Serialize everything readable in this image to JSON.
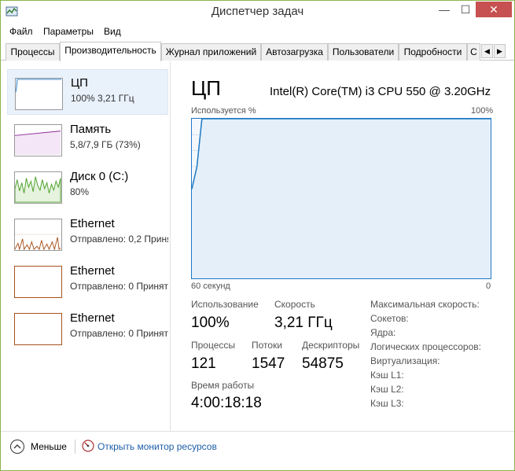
{
  "window": {
    "title": "Диспетчер задач",
    "close_glyph": "✕",
    "min_glyph": "—",
    "max_glyph": "☐"
  },
  "menu": [
    "Файл",
    "Параметры",
    "Вид"
  ],
  "tabs": [
    {
      "label": "Процессы",
      "active": false
    },
    {
      "label": "Производительность",
      "active": true
    },
    {
      "label": "Журнал приложений",
      "active": false
    },
    {
      "label": "Автозагрузка",
      "active": false
    },
    {
      "label": "Пользователи",
      "active": false
    },
    {
      "label": "Подробности",
      "active": false
    },
    {
      "label": "С",
      "active": false
    }
  ],
  "tab_scroll": {
    "left": "◀",
    "right": "▶"
  },
  "resources": [
    {
      "name": "ЦП",
      "sub": "100% 3,21 ГГц",
      "selected": true,
      "color": "#1d79c5"
    },
    {
      "name": "Память",
      "sub": "5,8/7,9 ГБ (73%)",
      "selected": false,
      "color": "#8b2a96"
    },
    {
      "name": "Диск 0 (C:)",
      "sub": "80%",
      "selected": false,
      "color": "#4ca22a"
    },
    {
      "name": "Ethernet",
      "sub": "Отправлено: 0,2 Приня",
      "selected": false,
      "color": "#a7521e"
    },
    {
      "name": "Ethernet",
      "sub": "Отправлено: 0 Принят",
      "selected": false,
      "color": "#a7521e"
    },
    {
      "name": "Ethernet",
      "sub": "Отправлено: 0 Принят",
      "selected": false,
      "color": "#a7521e"
    }
  ],
  "detail": {
    "title": "ЦП",
    "model": "Intel(R) Core(TM) i3 CPU 550 @ 3.20GHz",
    "chart_label_left": "Используется %",
    "chart_label_right": "100%",
    "axis_left": "60 секунд",
    "axis_right": "0",
    "usage_label": "Использование",
    "usage_value": "100%",
    "speed_label": "Скорость",
    "speed_value": "3,21 ГГц",
    "processes_label": "Процессы",
    "processes_value": "121",
    "threads_label": "Потоки",
    "threads_value": "1547",
    "handles_label": "Дескрипторы",
    "handles_value": "54875",
    "uptime_label": "Время работы",
    "uptime_value": "4:00:18:18",
    "specs": [
      "Максимальная скорость:",
      "Сокетов:",
      "Ядра:",
      "Логических процессоров:",
      "Виртуализация:",
      "Кэш L1:",
      "Кэш L2:",
      "Кэш L3:"
    ],
    "chart_color": "#1d79c5"
  },
  "cpu_history": [
    56,
    70,
    100,
    100,
    100,
    100,
    100,
    100,
    100,
    100,
    100,
    100,
    100,
    100,
    100,
    100,
    100,
    100,
    100,
    100,
    100,
    100,
    100,
    100,
    100,
    100,
    100,
    100,
    100,
    100,
    100,
    100,
    100,
    100,
    100,
    100,
    100,
    100,
    100,
    100,
    100,
    100,
    100,
    100,
    100,
    100,
    100,
    100,
    100,
    100,
    100,
    100,
    100,
    100,
    100,
    100,
    100,
    100,
    100,
    100
  ],
  "footer": {
    "less_label": "Меньше",
    "monitor_link": "Открыть монитор ресурсов"
  }
}
